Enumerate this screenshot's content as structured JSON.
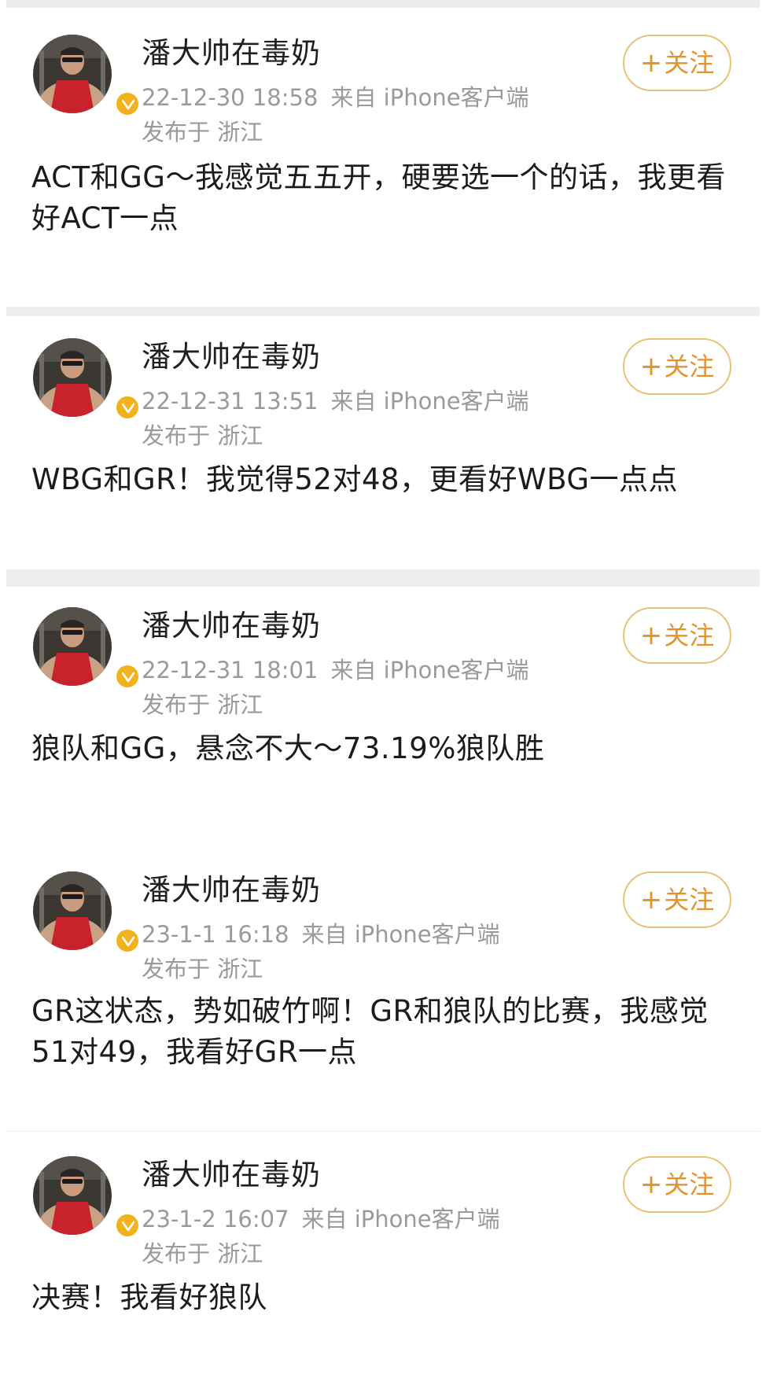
{
  "colors": {
    "follow_border": "#e9c27a",
    "follow_text": "#e4932a",
    "meta_text": "#9a9a9a",
    "body_text": "#1b1b1b",
    "verified_badge": "#f2b21b"
  },
  "posts": [
    {
      "username": "潘大帅在毒奶",
      "time": "22-12-30 18:58",
      "source": "来自 iPhone客户端",
      "location": "发布于 浙江",
      "follow_label": "关注",
      "text": "ACT和GG～我感觉五五开，硬要选一个的话，我更看好ACT一点"
    },
    {
      "username": "潘大帅在毒奶",
      "time": "22-12-31 13:51",
      "source": "来自 iPhone客户端",
      "location": "发布于 浙江",
      "follow_label": "关注",
      "text": "WBG和GR！我觉得52对48，更看好WBG一点点"
    },
    {
      "username": "潘大帅在毒奶",
      "time": "22-12-31 18:01",
      "source": "来自 iPhone客户端",
      "location": "发布于 浙江",
      "follow_label": "关注",
      "text": "狼队和GG，悬念不大～73.19%狼队胜"
    },
    {
      "username": "潘大帅在毒奶",
      "time": "23-1-1 16:18",
      "source": "来自 iPhone客户端",
      "location": "发布于 浙江",
      "follow_label": "关注",
      "text": "GR这状态，势如破竹啊！GR和狼队的比赛，我感觉51对49，我看好GR一点"
    },
    {
      "username": "潘大帅在毒奶",
      "time": "23-1-2 16:07",
      "source": "来自 iPhone客户端",
      "location": "发布于 浙江",
      "follow_label": "关注",
      "text": "决赛！我看好狼队"
    }
  ]
}
